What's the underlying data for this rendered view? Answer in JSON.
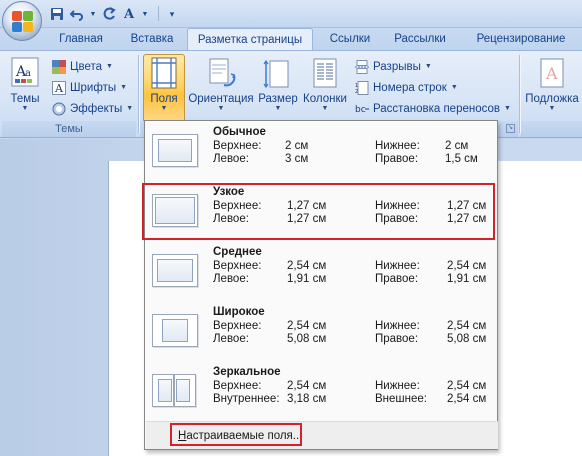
{
  "quick_access": {
    "undo_icon": "undo-icon",
    "redo_icon": "redo-icon",
    "save_icon": "save-icon"
  },
  "tabs": [
    {
      "label": "Главная"
    },
    {
      "label": "Вставка"
    },
    {
      "label": "Разметка страницы",
      "active": true
    },
    {
      "label": "Ссылки"
    },
    {
      "label": "Рассылки"
    },
    {
      "label": "Рецензирование"
    }
  ],
  "ribbon": {
    "themes_group": {
      "label": "Темы",
      "themes_button": "Темы",
      "colors": "Цвета",
      "fonts": "Шрифты",
      "effects": "Эффекты"
    },
    "page_setup": {
      "margins": "Поля",
      "orientation": "Ориентация",
      "size": "Размер",
      "columns": "Колонки",
      "breaks": "Разрывы",
      "line_numbers": "Номера строк",
      "hyphenation": "Расстановка переносов"
    },
    "page_background": {
      "substrate": "Подложка"
    }
  },
  "margins_menu": {
    "options": [
      {
        "name": "Обычное",
        "top_label": "Верхнее:",
        "top": "2 см",
        "bottom_label": "Нижнее:",
        "bottom": "2 см",
        "left_label": "Левое:",
        "left": "3 см",
        "right_label": "Правое:",
        "right": "1,5 см"
      },
      {
        "name": "Узкое",
        "top_label": "Верхнее:",
        "top": "1,27 см",
        "bottom_label": "Нижнее:",
        "bottom": "1,27 см",
        "left_label": "Левое:",
        "left": "1,27 см",
        "right_label": "Правое:",
        "right": "1,27 см"
      },
      {
        "name": "Среднее",
        "top_label": "Верхнее:",
        "top": "2,54 см",
        "bottom_label": "Нижнее:",
        "bottom": "2,54 см",
        "left_label": "Левое:",
        "left": "1,91 см",
        "right_label": "Правое:",
        "right": "1,91 см"
      },
      {
        "name": "Широкое",
        "top_label": "Верхнее:",
        "top": "2,54 см",
        "bottom_label": "Нижнее:",
        "bottom": "2,54 см",
        "left_label": "Левое:",
        "left": "5,08 см",
        "right_label": "Правое:",
        "right": "5,08 см"
      },
      {
        "name": "Зеркальное",
        "top_label": "Верхнее:",
        "top": "2,54 см",
        "bottom_label": "Нижнее:",
        "bottom": "2,54 см",
        "left_label": "Внутреннее:",
        "left": "3,18 см",
        "right_label": "Внешнее:",
        "right": "2,54 см"
      }
    ],
    "custom_label": "Настраиваемые поля..."
  },
  "colors": {
    "highlight": "#d2232a",
    "ribbon_active": "#ffd66b"
  }
}
